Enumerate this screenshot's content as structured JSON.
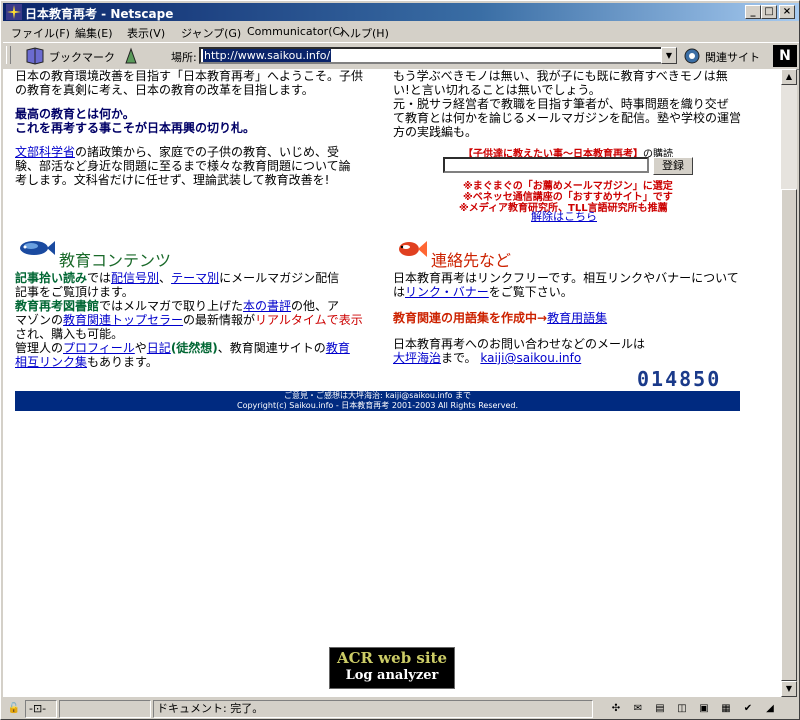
{
  "window": {
    "title": "日本教育再考 - Netscape"
  },
  "menu": [
    "ファイル(F)",
    "編集(E)",
    "表示(V)",
    "ジャンプ(G)",
    "Communicator(C)",
    "ヘルプ(H)"
  ],
  "toolbar": {
    "bookmarks_label": "ブックマーク",
    "location_label": "場所:",
    "url": "http://www.saikou.info/",
    "related_label": "関連サイト",
    "logo": "N"
  },
  "left": {
    "intro_line1": "日本の教育環境改善を目指す「日本教育再考」へようこそ。子供",
    "intro_line2": "の教育を真剣に考え、日本の教育の改革を目指します。",
    "heading1": "最高の教育とは何か。",
    "heading2": "これを再考する事こそが日本再興の切り札。",
    "mext_link": "文部科学省",
    "mext_text1": "の諸政策から、家庭での子供の教育、いじめ、受",
    "mext_text2": "験、部活など身近な問題に至るまで様々な教育問題について論",
    "mext_text3": "考します。文科省だけに任せず、理論武装して教育改善を!"
  },
  "right": {
    "text1": "もう学ぶべきモノは無い、我が子にも既に教育すべきモノは無",
    "text2": "い!と言い切れることは無いでしょう。",
    "text3": "元・脱サラ経営者で教職を目指す筆者が、時事問題を織り交ぜ",
    "text4": "て教育とは何かを論じるメールマガジンを配信。塾や学校の運営",
    "text5": "方の実践編も。"
  },
  "login": {
    "title_red": "【子供達に教えたい事〜日本教育再考】",
    "title_suffix": "の購読",
    "button": "登録"
  },
  "promos": {
    "p1": "※まぐまぐの「お薦めメールマガジン」に選定",
    "p2": "※ベネッセ通信講座の「おすすめサイト」です",
    "p3": "※メディア教育研究所、TLL言語研究所も推薦",
    "unsubscribe": "解除はこちら"
  },
  "contents": {
    "title": "教育コンテンツ",
    "l1_b": "記事拾い読み",
    "l1_t1": "では",
    "l1_a1": "配信号別",
    "l1_t2": "、",
    "l1_a2": "テーマ別",
    "l1_t3": "にメールマガジン配信",
    "l2": "記事をご覧頂けます。",
    "l3_b": "教育再考図書館",
    "l3_t1": "ではメルマガで取り上げた",
    "l3_a1": "本の書評",
    "l3_t2": "の他、ア",
    "l4_t1": "マゾンの",
    "l4_a1": "教育関連トップセラー",
    "l4_t2": "の最新情報が",
    "l4_red": "リアルタイムで表示",
    "l5": "され、購入も可能。",
    "l6_t1": "管理人の",
    "l6_a1": "プロフィール",
    "l6_t2": "や",
    "l6_a2": "日記",
    "l6_b": "(徒然想)",
    "l6_t3": "、教育関連サイトの",
    "l6_a3": "教育",
    "l7_a": "相互リンク集",
    "l7_t": "もあります。"
  },
  "contact": {
    "title": "連絡先など",
    "l1": "日本教育再考はリンクフリーです。相互リンクやバナーについて",
    "l2_t1": "は",
    "l2_a": "リンク・バナー",
    "l2_t2": "をご覧下さい。",
    "glossary_b": "教育関連の用語集を作成中→",
    "glossary_a": "教育用語集",
    "l4": "日本教育再考へのお問い合わせなどのメールは",
    "l5_a": "大坪海治",
    "l5_t": "まで。",
    "email": "kaiji@saikou.info"
  },
  "counter": "014850",
  "footer": {
    "line1": "ご意見・ご感想は大坪海治: kaiji@saikou.info まで",
    "line2": "Copyright(c) Saikou.info - 日本教育再考 2001-2003 All Rights Reserved."
  },
  "banner": {
    "line1": "ACR web site",
    "line2": "Log analyzer"
  },
  "status": {
    "text": "ドキュメント: 完了。"
  }
}
